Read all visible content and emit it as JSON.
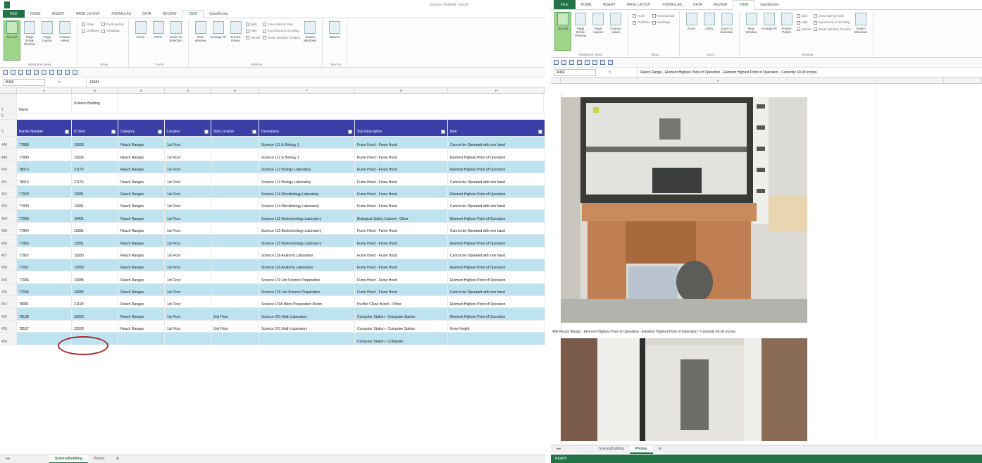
{
  "left": {
    "title": "Science Building - Excel",
    "tabs": [
      "FILE",
      "HOME",
      "INSERT",
      "PAGE LAYOUT",
      "FORMULAS",
      "DATA",
      "REVIEW",
      "VIEW",
      "QuickBooks"
    ],
    "ribbon": {
      "normal": "Normal",
      "page_break": "Page Break Preview",
      "page_layout": "Page Layout",
      "custom_views": "Custom Views",
      "ruler": "Ruler",
      "gridlines": "Gridlines",
      "formula_bar": "Formula Bar",
      "headings": "Headings",
      "zoom": "Zoom",
      "zoom100": "100%",
      "zoom_sel": "Zoom to Selection",
      "new_window": "New Window",
      "arrange_all": "Arrange All",
      "freeze": "Freeze Panes",
      "split": "Split",
      "hide": "Hide",
      "unhide": "Unhide",
      "side_by_side": "View Side by Side",
      "sync_scroll": "Synchronous Scrolling",
      "reset_pos": "Reset Window Position",
      "switch": "Switch Windows",
      "macros": "Macros",
      "g_views": "Workbook Views",
      "g_show": "Show",
      "g_zoom": "Zoom",
      "g_window": "Window",
      "g_macros": "Macros"
    },
    "name_box": "B456",
    "fx": "fx",
    "formula": "19381",
    "columns": [
      "A",
      "B",
      "C",
      "D",
      "E",
      "F",
      "G",
      "H"
    ],
    "name_row": {
      "label": "Name",
      "value": "Science Building"
    },
    "headers": [
      "Barrier Number",
      "ID Item",
      "Category",
      "Location",
      "Sub Location",
      "Description",
      "Sub Description",
      "Item"
    ],
    "rows": [
      {
        "n": "446",
        "a": "77889",
        "b": "19336",
        "c": "Reach Ranges",
        "d": "1st Floor",
        "e": "",
        "f": "Science 112 & Biology 1",
        "g": "Fume Hood - Fume Hood",
        "h": "Cannot be Operated with one hand",
        "band": true
      },
      {
        "n": "449",
        "a": "77880",
        "b": "19336",
        "c": "Reach Ranges",
        "d": "1st Floor",
        "e": "",
        "f": "Science 112 & Biology 1",
        "g": "Fume Hood - Fume Hood",
        "h": "Element Highest Point of Operation",
        "band": false
      },
      {
        "n": "450",
        "a": "78013",
        "b": "21179",
        "c": "Reach Ranges",
        "d": "1st Floor",
        "e": "",
        "f": "Science 113 Biology Laboratory",
        "g": "Fume Hood - Fume Hood",
        "h": "Element Highest Point of Operation",
        "band": true
      },
      {
        "n": "451",
        "a": "78013",
        "b": "21179",
        "c": "Reach Ranges",
        "d": "1st Floor",
        "e": "",
        "f": "Science 113 Biology Laboratory",
        "g": "Fume Hood - Fume Hood",
        "h": "Cannot be Operated with one hand",
        "band": false
      },
      {
        "n": "452",
        "a": "77929",
        "b": "19381",
        "c": "Reach Ranges",
        "d": "1st Floor",
        "e": "",
        "f": "Science 114 Microbiology Laboratory",
        "g": "Fume Hood - Fume Hood",
        "h": "Element Highest Point of Operation",
        "band": true
      },
      {
        "n": "453",
        "a": "77930",
        "b": "19381",
        "c": "Reach Ranges",
        "d": "1st Floor",
        "e": "",
        "f": "Science 114 Microbiology Laboratory",
        "g": "Fume Hood - Fume Hood",
        "h": "Cannot be Operated with one hand",
        "band": false
      },
      {
        "n": "454",
        "a": "77966",
        "b": "19401",
        "c": "Reach Ranges",
        "d": "1st Floor",
        "e": "",
        "f": "Science 115 Biotechnology Laboratory",
        "g": "Biological Safety Cabinet - Other",
        "h": "Element Highest Point of Operation",
        "band": true
      },
      {
        "n": "455",
        "a": "77964",
        "b": "19391",
        "c": "Reach Ranges",
        "d": "1st Floor",
        "e": "",
        "f": "Science 115 Biotechnology Laboratory",
        "g": "Fume Hood - Fume Hood",
        "h": "Cannot be Operated with one hand",
        "band": false
      },
      {
        "n": "456",
        "a": "77965",
        "b": "19391",
        "c": "Reach Ranges",
        "d": "1st Floor",
        "e": "",
        "f": "Science 115 Biotechnology Laboratory",
        "g": "Fume Hood - Fume Hood",
        "h": "Element Highest Point of Operation",
        "band": true
      },
      {
        "n": "457",
        "a": "77952",
        "b": "19383",
        "c": "Reach Ranges",
        "d": "1st Floor",
        "e": "",
        "f": "Science 116 Anatomy Laboratory",
        "g": "Fume Hood - Fume Hood",
        "h": "Cannot be Operated with one hand",
        "band": false
      },
      {
        "n": "458",
        "a": "77951",
        "b": "19383",
        "c": "Reach Ranges",
        "d": "1st Floor",
        "e": "",
        "f": "Science 116 Anatomy Laboratory",
        "g": "Fume Hood - Fume Hood",
        "h": "Element Highest Point of Operation",
        "band": true
      },
      {
        "n": "459",
        "a": "77936",
        "b": "19385",
        "c": "Reach Ranges",
        "d": "1st Floor",
        "e": "",
        "f": "Science 119 Life Science Preparation",
        "g": "Fume Hood - Fume Hood",
        "h": "Element Highest Point of Operation",
        "band": false
      },
      {
        "n": "460",
        "a": "77935",
        "b": "19385",
        "c": "Reach Ranges",
        "d": "1st Floor",
        "e": "",
        "f": "Science 119 Life Science Preparation",
        "g": "Fume Hood - Fume Hood",
        "h": "Cannot be Operated with one hand",
        "band": true
      },
      {
        "n": "461",
        "a": "78081",
        "b": "21190",
        "c": "Reach Ranges",
        "d": "1st Floor",
        "e": "",
        "f": "Science 119A Micro Preparation Room",
        "g": "Purifier Clean Bench - Other",
        "h": "Element Highest Point of Operation",
        "band": false
      },
      {
        "n": "462",
        "a": "78138",
        "b": "22620",
        "c": "Reach Ranges",
        "d": "1st Floor",
        "e": "2nd Floor",
        "f": "Science 201 Math Laboratory",
        "g": "Computer Station - Computer Station",
        "h": "Element Highest Point of Operation",
        "band": true
      },
      {
        "n": "463",
        "a": "78137",
        "b": "22620",
        "c": "Reach Ranges",
        "d": "1st Floor",
        "e": "2nd Floor",
        "f": "Science 201 Math Laboratory",
        "g": "Computer Station - Computer Station",
        "h": "Knee Height",
        "band": false
      },
      {
        "n": "464",
        "a": "",
        "b": "",
        "c": "",
        "d": "",
        "e": "",
        "f": "",
        "g": "Computer Station - Computer",
        "h": "",
        "band": true
      }
    ],
    "sheet_tabs": [
      "ScienceBuilding",
      "Photos"
    ]
  },
  "right": {
    "tabs": [
      "FILE",
      "HOME",
      "INSERT",
      "PAGE LAYOUT",
      "FORMULAS",
      "DATA",
      "REVIEW",
      "VIEW",
      "QuickBooks"
    ],
    "name_box": "A456",
    "formula": "Reach Range , Element Highest Point of Operation - Element Highest Point of Operation - Currently 60.00 inches",
    "column_a": "A",
    "caption": "456 Reach Range , Element Highest Point of Operation - Element Highest Point of Operation - Currently 60.00 inches",
    "sheet_tabs": [
      "ScienceBuilding",
      "Photos"
    ],
    "status": "READY"
  }
}
